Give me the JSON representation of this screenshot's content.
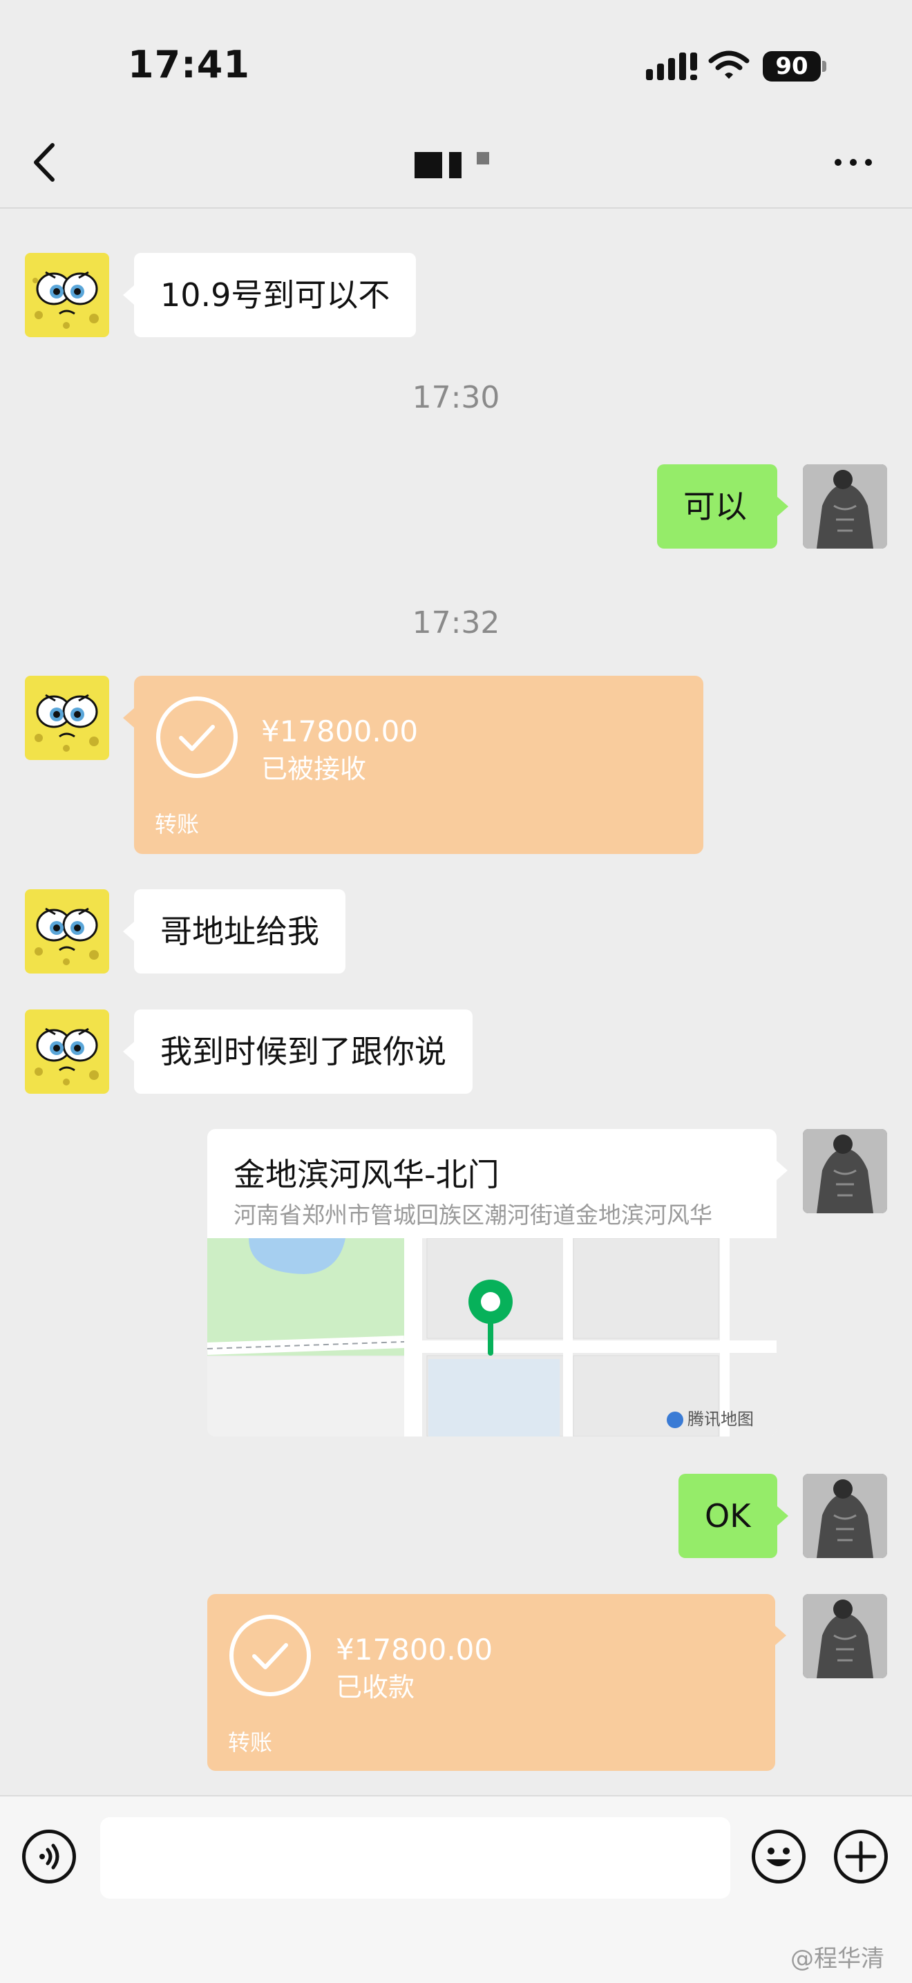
{
  "status_bar": {
    "time": "17:41",
    "battery": "90"
  },
  "chat": {
    "messages": [
      {
        "side": "left",
        "text": "10.9号到可以不"
      },
      {
        "timestamp": "17:30"
      },
      {
        "side": "right",
        "text": "可以"
      },
      {
        "timestamp": "17:32"
      },
      {
        "side": "left",
        "type": "transfer",
        "amount": "¥17800.00",
        "status": "已被接收",
        "label": "转账"
      },
      {
        "side": "left",
        "text": "哥地址给我"
      },
      {
        "side": "left",
        "text": "我到时候到了跟你说"
      },
      {
        "side": "right",
        "type": "location",
        "title": "金地滨河风华-北门",
        "address": "河南省郑州市管城回族区潮河街道金地滨河风华",
        "map_provider": "腾讯地图"
      },
      {
        "side": "right",
        "text": "OK"
      },
      {
        "side": "right",
        "type": "transfer",
        "amount": "¥17800.00",
        "status": "已收款",
        "label": "转账"
      }
    ]
  },
  "watermark": "@程华清",
  "icons": {
    "back": "chevron-left-icon",
    "more": "more-icon",
    "voice": "voice-icon",
    "emoji": "emoji-icon",
    "plus": "plus-icon",
    "signal": "signal-icon",
    "wifi": "wifi-icon",
    "check": "check-icon",
    "map_pin": "map-pin-icon"
  },
  "colors": {
    "background": "#ededed",
    "green_bubble": "#95ec69",
    "transfer": "#f9cc9d",
    "pin": "#07b15a"
  }
}
